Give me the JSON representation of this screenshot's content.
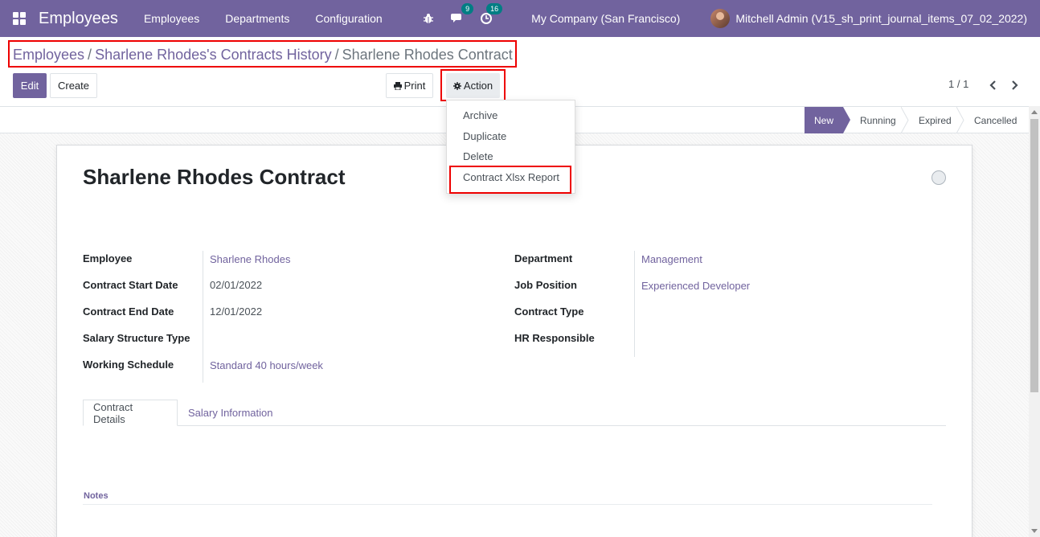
{
  "navbar": {
    "app_title": "Employees",
    "menu": [
      "Employees",
      "Departments",
      "Configuration"
    ],
    "messages_count": "9",
    "activities_count": "16",
    "company": "My Company (San Francisco)",
    "user": "Mitchell Admin (V15_sh_print_journal_items_07_02_2022)"
  },
  "breadcrumb": {
    "items": [
      "Employees",
      "Sharlene Rhodes's Contracts History"
    ],
    "current": "Sharlene Rhodes Contract",
    "separator": "/"
  },
  "buttons": {
    "edit": "Edit",
    "create": "Create",
    "print": "Print",
    "action": "Action"
  },
  "pager": {
    "value": "1 / 1"
  },
  "action_menu": [
    "Archive",
    "Duplicate",
    "Delete",
    "Contract Xlsx Report"
  ],
  "stages": [
    "New",
    "Running",
    "Expired",
    "Cancelled"
  ],
  "form": {
    "title": "Sharlene Rhodes Contract",
    "left_fields": [
      {
        "label": "Employee",
        "value": "Sharlene Rhodes"
      },
      {
        "label": "Contract Start Date",
        "value": "02/01/2022"
      },
      {
        "label": "Contract End Date",
        "value": "12/01/2022"
      },
      {
        "label": "Salary Structure Type",
        "value": ""
      },
      {
        "label": "Working Schedule",
        "value": "Standard 40 hours/week"
      }
    ],
    "right_fields": [
      {
        "label": "Department",
        "value": "Management"
      },
      {
        "label": "Job Position",
        "value": "Experienced Developer"
      },
      {
        "label": "Contract Type",
        "value": ""
      },
      {
        "label": "HR Responsible",
        "value": ""
      }
    ],
    "tabs": [
      "Contract Details",
      "Salary Information"
    ],
    "notes_label": "Notes"
  },
  "colors": {
    "brand": "#71639e",
    "badge": "#017e84",
    "highlight": "#ee0000"
  }
}
